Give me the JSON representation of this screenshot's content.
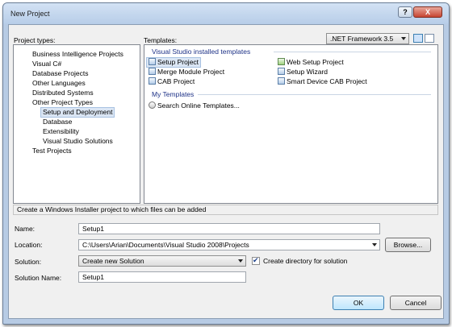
{
  "window": {
    "title": "New Project",
    "help": "?",
    "close": "X"
  },
  "project_types": {
    "label": "Project types:",
    "items": [
      "Business Intelligence Projects",
      "Visual C#",
      "Database Projects",
      "Other Languages",
      "Distributed Systems",
      "Other Project Types",
      "Setup and Deployment",
      "Database",
      "Extensibility",
      "Visual Studio Solutions",
      "Test Projects"
    ]
  },
  "templates": {
    "label": "Templates:",
    "framework": ".NET Framework 3.5",
    "installed_header": "Visual Studio installed templates",
    "installed": [
      "Setup Project",
      "Web Setup Project",
      "Merge Module Project",
      "Setup Wizard",
      "CAB Project",
      "Smart Device CAB Project"
    ],
    "my_header": "My Templates",
    "my": [
      "Search Online Templates..."
    ]
  },
  "description": "Create a Windows Installer project to which files can be added",
  "form": {
    "name_label": "Name:",
    "name_value": "Setup1",
    "location_label": "Location:",
    "location_value": "C:\\Users\\Arian\\Documents\\Visual Studio 2008\\Projects",
    "browse": "Browse...",
    "solution_label": "Solution:",
    "solution_value": "Create new Solution",
    "create_dir_label": "Create directory for solution",
    "create_dir_checked": true,
    "solution_name_label": "Solution Name:",
    "solution_name_value": "Setup1"
  },
  "buttons": {
    "ok": "OK",
    "cancel": "Cancel"
  }
}
